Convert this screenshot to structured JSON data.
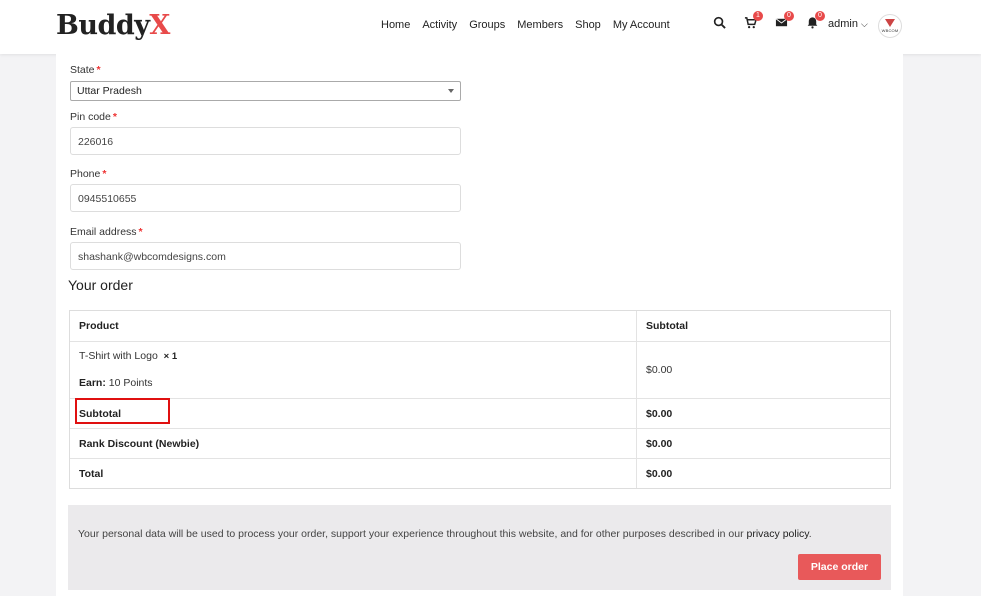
{
  "brand": {
    "name_main": "Buddy",
    "name_accent": "X"
  },
  "nav": [
    "Home",
    "Activity",
    "Groups",
    "Members",
    "Shop",
    "My Account"
  ],
  "header_icons": [
    {
      "name": "search-icon",
      "badge": ""
    },
    {
      "name": "cart-icon",
      "badge": "1"
    },
    {
      "name": "mail-icon",
      "badge": "0"
    },
    {
      "name": "bell-icon",
      "badge": "0"
    }
  ],
  "user": {
    "name": "admin",
    "avatar_text": "WBCOM"
  },
  "form": {
    "state": {
      "label": "State",
      "required": "*",
      "value": "Uttar Pradesh"
    },
    "pincode": {
      "label": "Pin code",
      "required": "*",
      "value": "226016"
    },
    "phone": {
      "label": "Phone",
      "required": "*",
      "value": "0945510655"
    },
    "email": {
      "label": "Email address",
      "required": "*",
      "value": "shashank@wbcomdesigns.com"
    }
  },
  "order": {
    "title": "Your order",
    "headers": {
      "product": "Product",
      "subtotal": "Subtotal"
    },
    "item": {
      "name": "T-Shirt with Logo",
      "qty": "× 1",
      "earn_label": "Earn:",
      "earn_value": "10 Points",
      "price": "$0.00"
    },
    "rows": [
      {
        "label": "Subtotal",
        "value": "$0.00"
      },
      {
        "label": "Rank Discount (Newbie)",
        "value": "$0.00"
      },
      {
        "label": "Total",
        "value": "$0.00"
      }
    ]
  },
  "privacy": {
    "text": "Your personal data will be used to process your order, support your experience throughout this website, and for other purposes described in our",
    "link": "privacy policy",
    "end": "."
  },
  "place_order": "Place order",
  "colors": {
    "accent": "#e84a4a",
    "button": "#e8595a",
    "highlight": "#e01010"
  }
}
